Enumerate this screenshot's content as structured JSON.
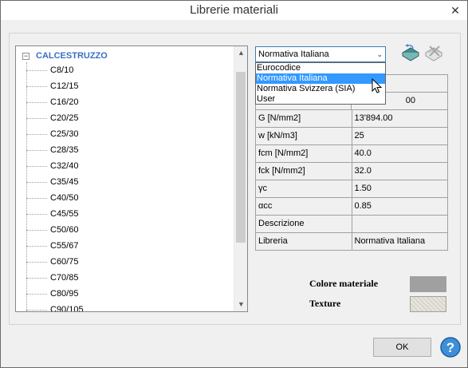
{
  "window": {
    "title": "Librerie materiali",
    "close_glyph": "✕"
  },
  "tree": {
    "root_label": "CALCESTRUZZO",
    "expander_glyph": "−",
    "items": [
      "C8/10",
      "C12/15",
      "C16/20",
      "C20/25",
      "C25/30",
      "C28/35",
      "C32/40",
      "C35/45",
      "C40/50",
      "C45/55",
      "C50/60",
      "C55/67",
      "C60/75",
      "C70/85",
      "C80/95",
      "C90/105"
    ],
    "scroll_up_glyph": "▲",
    "scroll_down_glyph": "▼"
  },
  "library_select": {
    "value": "Normativa Italiana",
    "arrow_glyph": "⌄",
    "options": [
      "Eurocodice",
      "Normativa Italiana",
      "Normativa Svizzera (SIA)",
      "User"
    ],
    "selected_index": 1
  },
  "toolbar": {
    "add_icon": "add-book-icon",
    "delete_icon": "delete-book-icon"
  },
  "properties": [
    {
      "label": "",
      "value": ""
    },
    {
      "label": "",
      "value": "00"
    },
    {
      "label": "G [N/mm2]",
      "value": "13'894.00"
    },
    {
      "label": "w [kN/m3]",
      "value": "25"
    },
    {
      "label": "fcm [N/mm2]",
      "value": "40.0"
    },
    {
      "label": "fck [N/mm2]",
      "value": "32.0"
    },
    {
      "label": "γc",
      "value": "1.50"
    },
    {
      "label": "αcc",
      "value": "0.85"
    },
    {
      "label": "Descrizione",
      "value": ""
    },
    {
      "label": "Libreria",
      "value": "Normativa Italiana"
    }
  ],
  "material_color": {
    "label": "Colore materiale",
    "color": "#a0a0a0"
  },
  "texture": {
    "label": "Texture"
  },
  "buttons": {
    "ok": "OK",
    "help_icon": "help-icon"
  }
}
